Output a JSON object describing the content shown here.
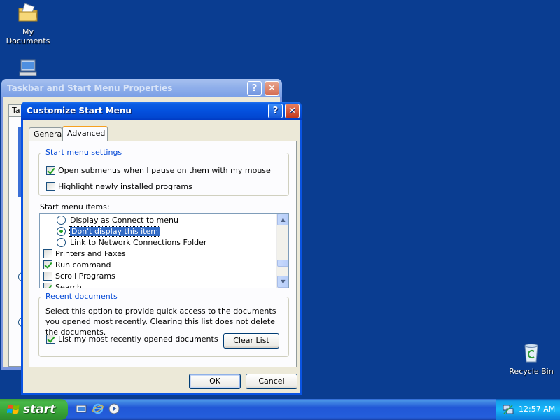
{
  "desktop": {
    "icons": [
      {
        "label": "My Documents",
        "icon": "folder-documents-icon"
      },
      {
        "label": "",
        "icon": "my-computer-icon"
      },
      {
        "label": "Recycle Bin",
        "icon": "recycle-bin-icon"
      }
    ]
  },
  "back_window": {
    "title": "Taskbar and Start Menu Properties",
    "tab_partial": "Ta",
    "help_symbol": "?",
    "close_symbol": "✕"
  },
  "dialog": {
    "title": "Customize Start Menu",
    "help_symbol": "?",
    "close_symbol": "✕",
    "tabs": [
      {
        "label": "General",
        "active": false
      },
      {
        "label": "Advanced",
        "active": true
      }
    ],
    "settings_group": {
      "title": "Start menu settings",
      "open_submenus": {
        "label": "Open submenus when I pause on them with my mouse",
        "checked": true
      },
      "highlight_new": {
        "label": "Highlight newly installed programs",
        "checked": false
      }
    },
    "items_label": "Start menu items:",
    "items": [
      {
        "type": "radio",
        "label": "Display as Connect to menu",
        "checked": false
      },
      {
        "type": "radio",
        "label": "Don't display this item",
        "checked": true
      },
      {
        "type": "radio",
        "label": "Link to Network Connections Folder",
        "checked": false
      },
      {
        "type": "check",
        "label": "Printers and Faxes",
        "checked": false
      },
      {
        "type": "check",
        "label": "Run command",
        "checked": true
      },
      {
        "type": "check",
        "label": "Scroll Programs",
        "checked": false
      },
      {
        "type": "check",
        "label": "Search",
        "checked": true
      }
    ],
    "recent_group": {
      "title": "Recent documents",
      "description": "Select this option to provide quick access to the documents you opened most recently.  Clearing this list does not delete the documents.",
      "list_recent": {
        "label": "List my most recently opened documents",
        "checked": true
      },
      "clear_label": "Clear List"
    },
    "ok_label": "OK",
    "cancel_label": "Cancel"
  },
  "taskbar": {
    "start_label": "start",
    "quick_launch": [
      "desktop-icon",
      "internet-explorer-icon",
      "media-player-icon"
    ],
    "clock": "12:57 AM",
    "tray_icon": "network-icon"
  },
  "colors": {
    "desktop": "#0a3d91",
    "title_active": "#0451de",
    "title_inactive": "#8eaeea",
    "dialog_face": "#ece9d8",
    "group_title": "#0046d5",
    "selection": "#316ac5",
    "start_green": "#37a337"
  }
}
